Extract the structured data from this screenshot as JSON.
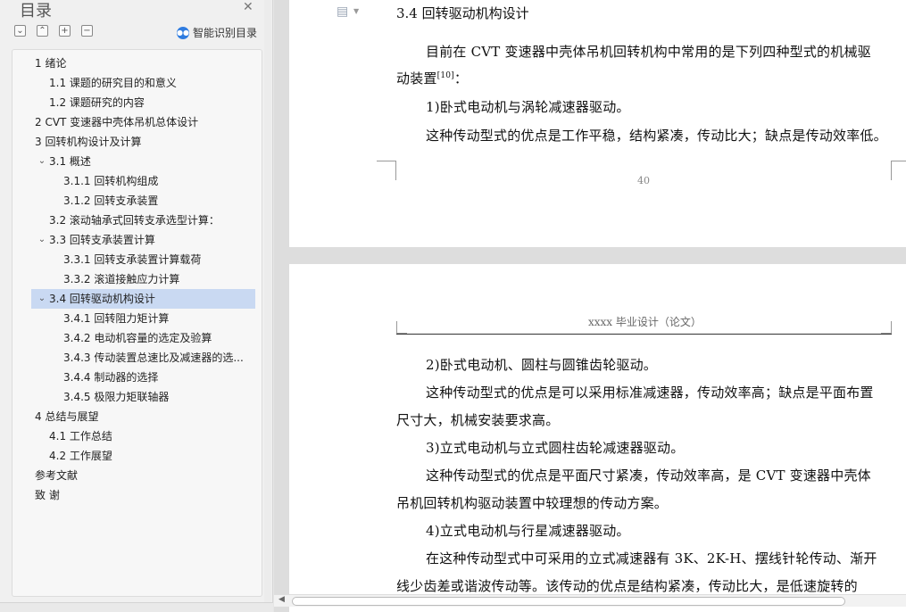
{
  "sidebar": {
    "title": "目录",
    "close_icon": "close-icon",
    "tools": [
      "collapse-icon",
      "expand-up-icon",
      "plus-icon",
      "minus-icon"
    ],
    "smart_label": "智能识别目录",
    "toc": [
      {
        "id": "ch1",
        "arrow": "down",
        "text": "1  绪论"
      },
      {
        "id": "1-1",
        "arrow": "",
        "text": "1.1  课题的研究目的和意义"
      },
      {
        "id": "1-2",
        "arrow": "",
        "text": "1.2  课题研究的内容"
      },
      {
        "id": "ch2",
        "arrow": "right",
        "text": "2  CVT 变速器中壳体吊机总体设计"
      },
      {
        "id": "ch3",
        "arrow": "down",
        "text": "3  回转机构设计及计算"
      },
      {
        "id": "3-1",
        "arrow": "down",
        "text": "3.1  概述"
      },
      {
        "id": "3-1-1",
        "arrow": "",
        "text": "3.1.1  回转机构组成"
      },
      {
        "id": "3-1-2",
        "arrow": "",
        "text": "3.1.2  回转支承装置"
      },
      {
        "id": "3-2",
        "arrow": "",
        "text": "3.2  滚动轴承式回转支承选型计算："
      },
      {
        "id": "3-3",
        "arrow": "down",
        "text": "3.3  回转支承装置计算"
      },
      {
        "id": "3-3-1",
        "arrow": "",
        "text": "3.3.1  回转支承装置计算载荷"
      },
      {
        "id": "3-3-2",
        "arrow": "",
        "text": "3.3.2  滚道接触应力计算"
      },
      {
        "id": "3-4",
        "arrow": "down",
        "text": "3.4  回转驱动机构设计"
      },
      {
        "id": "3-4-1",
        "arrow": "",
        "text": "3.4.1  回转阻力矩计算"
      },
      {
        "id": "3-4-2",
        "arrow": "",
        "text": "3.4.2  电动机容量的选定及验算"
      },
      {
        "id": "3-4-3",
        "arrow": "",
        "text": "3.4.3  传动装置总速比及减速器的选..."
      },
      {
        "id": "3-4-4",
        "arrow": "",
        "text": "3.4.4  制动器的选择"
      },
      {
        "id": "3-4-5",
        "arrow": "",
        "text": "3.4.5  极限力矩联轴器"
      },
      {
        "id": "ch4",
        "arrow": "down",
        "text": "4  总结与展望"
      },
      {
        "id": "4-1",
        "arrow": "",
        "text": "4.1  工作总结"
      },
      {
        "id": "4-2",
        "arrow": "",
        "text": "4.2  工作展望"
      },
      {
        "id": "ref",
        "arrow": "",
        "text": "参考文献"
      },
      {
        "id": "thx",
        "arrow": "",
        "text": "致    谢"
      }
    ],
    "selected": "3-4"
  },
  "document": {
    "heading": "3.4  回转驱动机构设计",
    "page1": {
      "p1_line1": "目前在 CVT 变速器中壳体吊机回转机构中常用的是下列四种型式的机械驱",
      "p1_line2": "动装置",
      "p1_ref": "[10]",
      "p1_line2_end": "：",
      "p2": "1)卧式电动机与涡轮减速器驱动。",
      "p3": "这种传动型式的优点是工作平稳，结构紧凑，传动比大；缺点是传动效率低。",
      "page_number": "40"
    },
    "page2": {
      "header": "xxxx 毕业设计（论文）",
      "lines": [
        "2)卧式电动机、圆柱与圆锥齿轮驱动。",
        "这种传动型式的优点是可以采用标准减速器，传动效率高；缺点是平面布置",
        "尺寸大，机械安装要求高。",
        "3)立式电动机与立式圆柱齿轮减速器驱动。",
        "这种传动型式的优点是平面尺寸紧凑，传动效率高，是 CVT 变速器中壳体",
        "吊机回转机构驱动装置中较理想的传动方案。",
        "4)立式电动机与行星减速器驱动。",
        "在这种传动型式中可采用的立式减速器有 3K、2K-H、摆线针轮传动、渐开",
        "线少齿差或谐波传动等。该传动的优点是结构紧凑，传动比大，是低速旋转的"
      ]
    }
  }
}
